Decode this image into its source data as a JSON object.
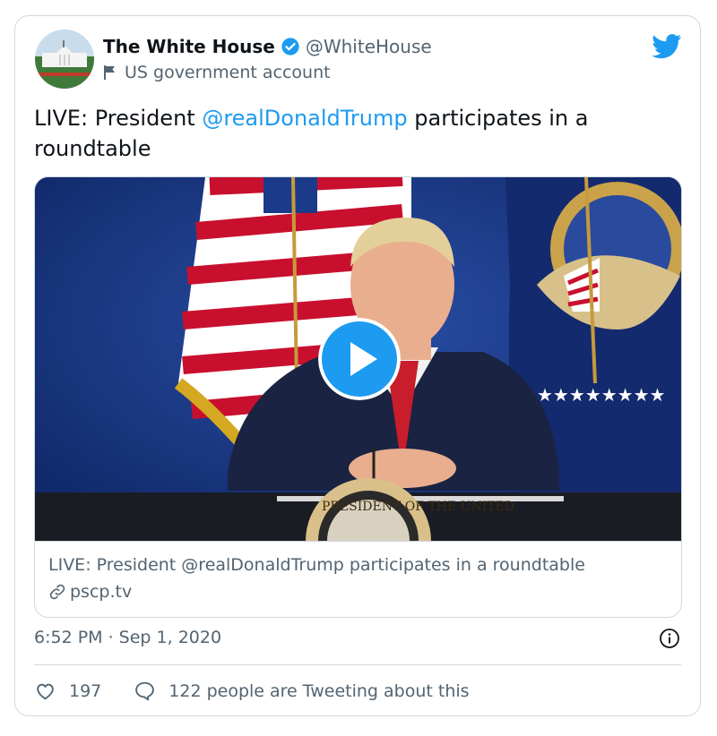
{
  "tweet": {
    "author_name": "The White House",
    "handle": "@WhiteHouse",
    "account_label": "US government account",
    "text_prefix": "LIVE: President ",
    "mention": "@realDonaldTrump",
    "text_suffix": " participates in a roundtable",
    "timestamp": "6:52 PM · Sep 1, 2020",
    "likes": "197",
    "replies_text": "122 people are Tweeting about this"
  },
  "card": {
    "title": "LIVE: President @realDonaldTrump participates in a roundtable",
    "domain": "pscp.tv"
  },
  "icons": {
    "verified": "verified-badge-icon",
    "government": "flag-icon",
    "brand": "twitter-bird-icon",
    "play": "play-icon",
    "link": "link-icon",
    "info": "info-icon",
    "like": "heart-icon",
    "reply": "speech-bubble-icon"
  },
  "colors": {
    "accent": "#1d9bf0",
    "text": "#0f1419",
    "muted": "#536471",
    "border": "#cfd9de"
  }
}
